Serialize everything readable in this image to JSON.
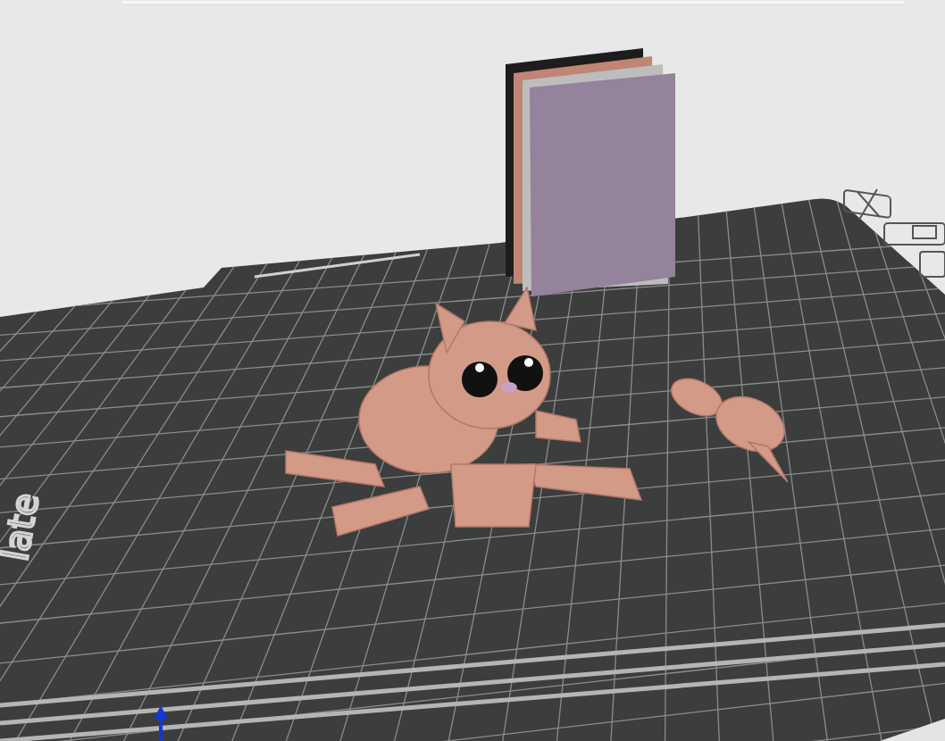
{
  "viewport": {
    "bed_label": "late"
  }
}
